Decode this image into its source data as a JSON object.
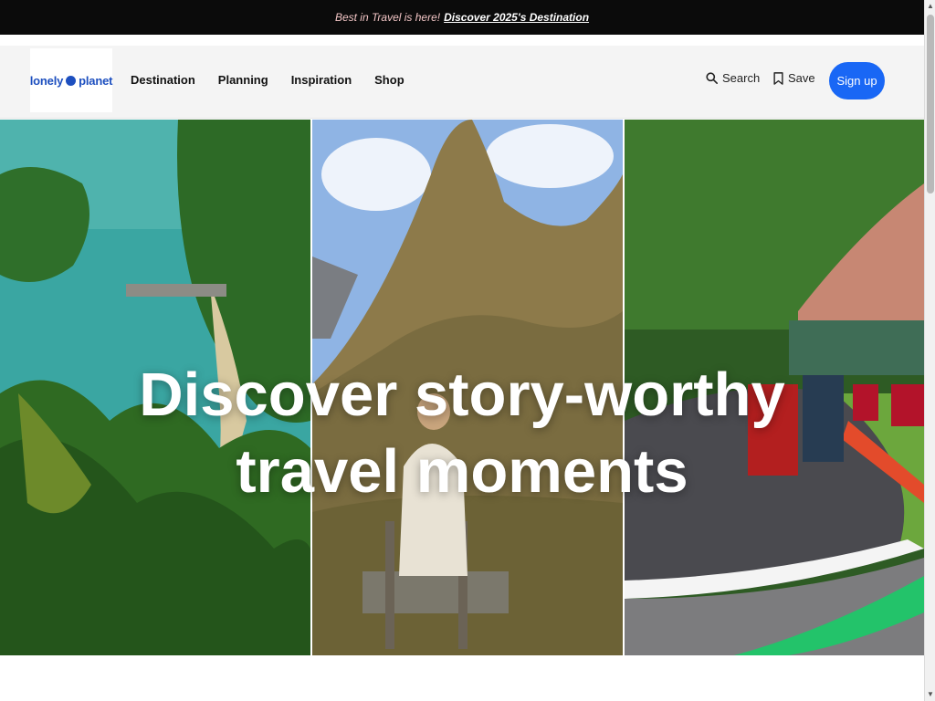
{
  "promo": {
    "text": "Best in Travel is here!",
    "link": "Discover 2025's Destination"
  },
  "header": {
    "logo_text_left": "lonely",
    "logo_text_right": "planet",
    "nav": [
      {
        "label": "Destination"
      },
      {
        "label": "Planning"
      },
      {
        "label": "Inspiration"
      },
      {
        "label": "Shop"
      }
    ],
    "search_label": "Search",
    "save_label": "Save",
    "signup_label": "Sign up"
  },
  "hero": {
    "title_line1": "Discover story-worthy",
    "title_line2": "travel moments"
  },
  "colors": {
    "brand": "#1d4fbf",
    "signup": "#1967f5",
    "promo_bg": "#0b0b0b",
    "promo_text": "#f2c5c5"
  },
  "icons": [
    "search-icon",
    "bookmark-icon",
    "globe-icon"
  ]
}
